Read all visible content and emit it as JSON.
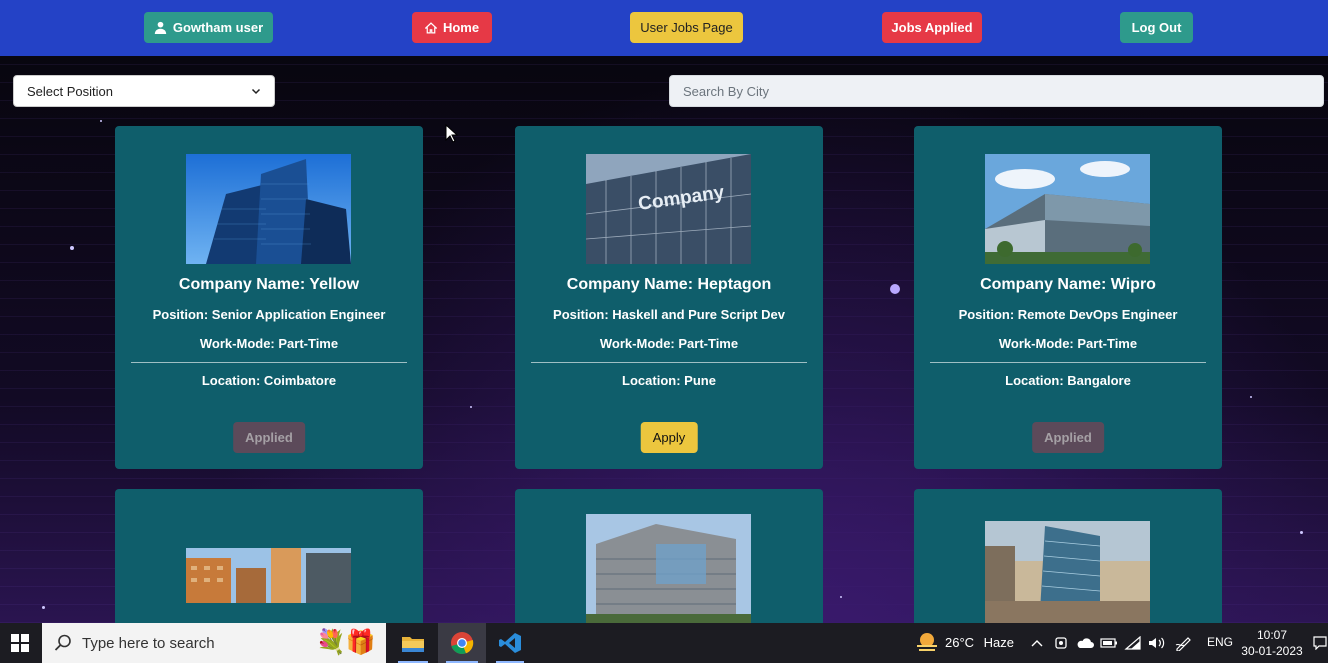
{
  "navbar": {
    "user_label": "Gowtham user",
    "home_label": "Home",
    "user_jobs_label": "User Jobs Page",
    "jobs_applied_label": "Jobs Applied",
    "logout_label": "Log Out"
  },
  "filters": {
    "position_select": "Select Position",
    "city_placeholder": "Search By City"
  },
  "cards": [
    {
      "title": "Company Name: Yellow",
      "position": "Position: Senior Application Engineer",
      "work_mode": "Work-Mode: Part-Time",
      "location": "Location: Coimbatore",
      "button": "Applied"
    },
    {
      "title": "Company Name: Heptagon",
      "position": "Position: Haskell and Pure Script Dev",
      "work_mode": "Work-Mode: Part-Time",
      "location": "Location: Pune",
      "button": "Apply",
      "image_text": "Company"
    },
    {
      "title": "Company Name: Wipro",
      "position": "Position: Remote DevOps Engineer",
      "work_mode": "Work-Mode: Part-Time",
      "location": "Location: Bangalore",
      "button": "Applied"
    }
  ],
  "taskbar": {
    "search_placeholder": "Type here to search",
    "weather_temp": "26°C",
    "weather_desc": "Haze",
    "language": "ENG",
    "time": "10:07",
    "date": "30-01-2023"
  },
  "colors": {
    "navbar": "#2442c6",
    "teal_button": "#2e9a8c",
    "red_button": "#e63946",
    "yellow_button": "#ecc63e",
    "card": "#0f5e6b",
    "applied_button": "#5c4a5a"
  }
}
